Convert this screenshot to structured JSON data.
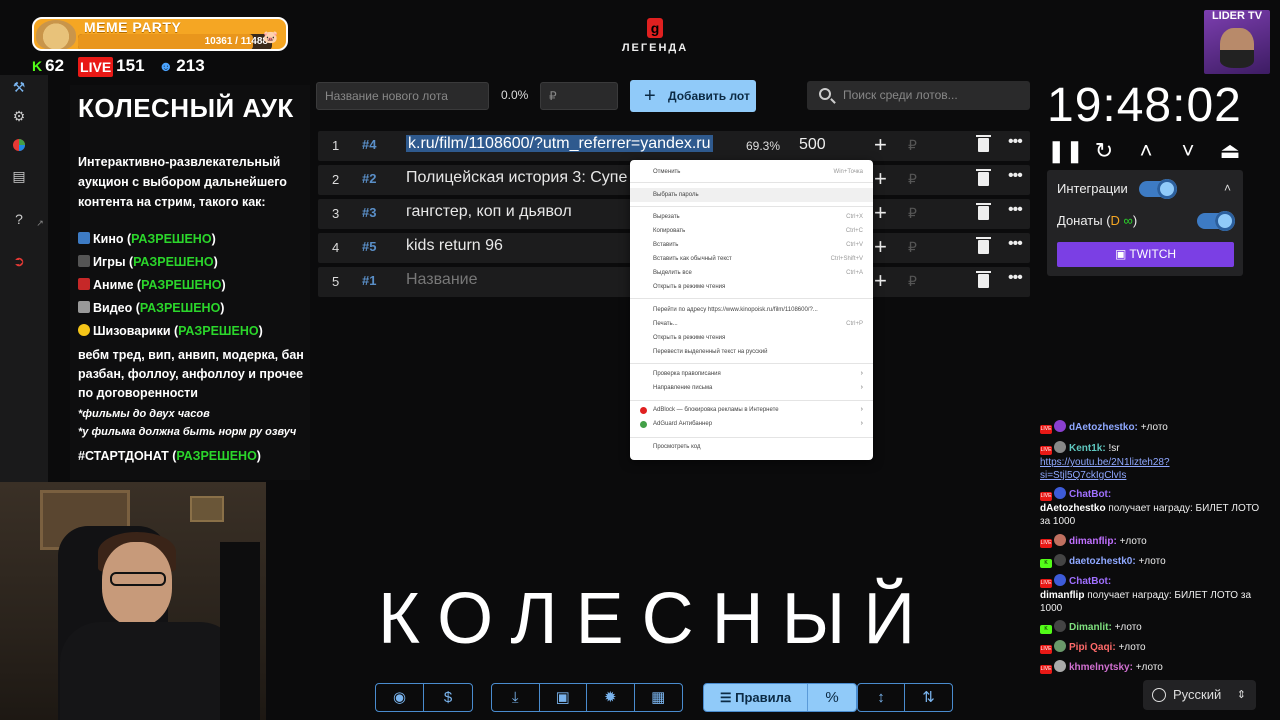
{
  "overlay": {
    "meme_title": "MEME PARTY",
    "meme_progress_text": "10361 / 11488",
    "meme_progress": 0.9,
    "kick_count": "62",
    "live_label": "LIVE",
    "live_count": "151",
    "viewers_count": "213",
    "logo_mark": "g",
    "logo_word": "ЛЕГЕНДА",
    "lider_label": "LIDER TV"
  },
  "info": {
    "title": "КОЛЕСНЫЙ АУК",
    "description": "Интерактивно-развлекательный аукцион с выбором дальнейшего контента на стрим, такого как:",
    "items": [
      {
        "label": "Кино (",
        "status": "РАЗРЕШЕНО",
        "tail": ")"
      },
      {
        "label": "Игры (",
        "status": "РАЗРЕШЕНО",
        "tail": ")"
      },
      {
        "label": "Аниме (",
        "status": "РАЗРЕШЕНО",
        "tail": ")"
      },
      {
        "label": "Видео (",
        "status": "РАЗРЕШЕНО",
        "tail": ")"
      },
      {
        "label": "Шизоварики (",
        "status": "РАЗРЕШЕНО",
        "tail": ")"
      }
    ],
    "misc": "вебм тред, вип, анвип, модерка, бан разбан, фоллоу, анфоллоу и прочее по договоренности",
    "note1": "*фильмы до двух часов",
    "note2": "*у фильма должна быть норм ру озвуч",
    "startdonat_label": "#СТАРТДОНАТ (",
    "startdonat_status": "РАЗРЕШЕНО",
    "startdonat_tail": ")"
  },
  "toolbar": {
    "new_lot_placeholder": "Название нового лота",
    "percent": "0.0%",
    "amount_placeholder": "₽",
    "add_button": "Добавить лот",
    "search_placeholder": "Поиск среди лотов..."
  },
  "lots": [
    {
      "num": "1",
      "id": "#4",
      "name": "k.ru/film/1108600/?utm_referrer=yandex.ru",
      "pct": "69.3%",
      "amount": "500"
    },
    {
      "num": "2",
      "id": "#2",
      "name": "Полицейская история 3: Супе",
      "pct": "",
      "amount": ""
    },
    {
      "num": "3",
      "id": "#3",
      "name": "гангстер, коп и дьявол",
      "pct": "",
      "amount": ""
    },
    {
      "num": "4",
      "id": "#5",
      "name": "kids return 96",
      "pct": "",
      "amount": ""
    },
    {
      "num": "5",
      "id": "#1",
      "name": "Название",
      "pct": "",
      "amount": ""
    }
  ],
  "rub": "₽",
  "context_menu": {
    "undo": "Отменить",
    "undo_sc": "Win+Точка",
    "select_password": "Выбрать пароль",
    "cut": "Вырезать",
    "cut_sc": "Ctrl+X",
    "copy": "Копировать",
    "copy_sc": "Ctrl+C",
    "paste": "Вставить",
    "paste_sc": "Ctrl+V",
    "paste_plain": "Вставить как обычный текст",
    "paste_plain_sc": "Ctrl+Shift+V",
    "select_all": "Выделить все",
    "select_all_sc": "Ctrl+A",
    "reading_mode": "Открыть в режиме чтения",
    "goto": "Перейти по адресу https://www.kinopoisk.ru/film/1108600/?...",
    "print": "Печать...",
    "print_sc": "Ctrl+P",
    "reading_mode2": "Открыть в режиме чтения",
    "translate": "Перевести выделенный текст на русский",
    "spell": "Проверка правописания",
    "direction": "Направление письма",
    "adblock": "AdBlock — блокировка рекламы в Интернете",
    "adguard": "AdGuard Антибаннер",
    "inspect": "Просмотреть код"
  },
  "big_word": "КОЛЕСНЫЙ",
  "bottom": {
    "rules_label": "Правила",
    "language": "Русский"
  },
  "timer": {
    "time": "19:48:02"
  },
  "integrations": {
    "title": "Интеграции",
    "donations_label": "Донаты (",
    "donations_tail": ")",
    "twitch": "TWITCH"
  },
  "chat": [
    {
      "user": "dAetozhestko:",
      "text": "+лото",
      "color": "#8fa8ff"
    },
    {
      "user": "Kent1k:",
      "text": "!sr",
      "color": "#5fc8c0"
    },
    {
      "user": "",
      "text": "https://youtu.be/2N1lizteh28?si=Stjl5Q7ckIgClvIs",
      "color": ""
    },
    {
      "user": "ChatBot:",
      "text": "",
      "color": "#a070ff"
    },
    {
      "user": "dAetozhestko",
      "text": "получает награду: БИЛЕТ ЛОТО за 1000",
      "color": "#fff"
    },
    {
      "user": "dimanflip:",
      "text": "+лото",
      "color": "#c070ff"
    },
    {
      "user": "daetozhestk0:",
      "text": "+лото",
      "color": "#8fa8ff"
    },
    {
      "user": "ChatBot:",
      "text": "",
      "color": "#a070ff"
    },
    {
      "user": "dimanflip",
      "text": "получает награду: БИЛЕТ ЛОТО за 1000",
      "color": "#fff"
    },
    {
      "user": "Dimanlit:",
      "text": "+лото",
      "color": "#7fe07f"
    },
    {
      "user": "Pipi Qaqi:",
      "text": "+лото",
      "color": "#ff6a6a"
    },
    {
      "user": "khmelnytsky:",
      "text": "+лото",
      "color": "#d070d0"
    }
  ]
}
